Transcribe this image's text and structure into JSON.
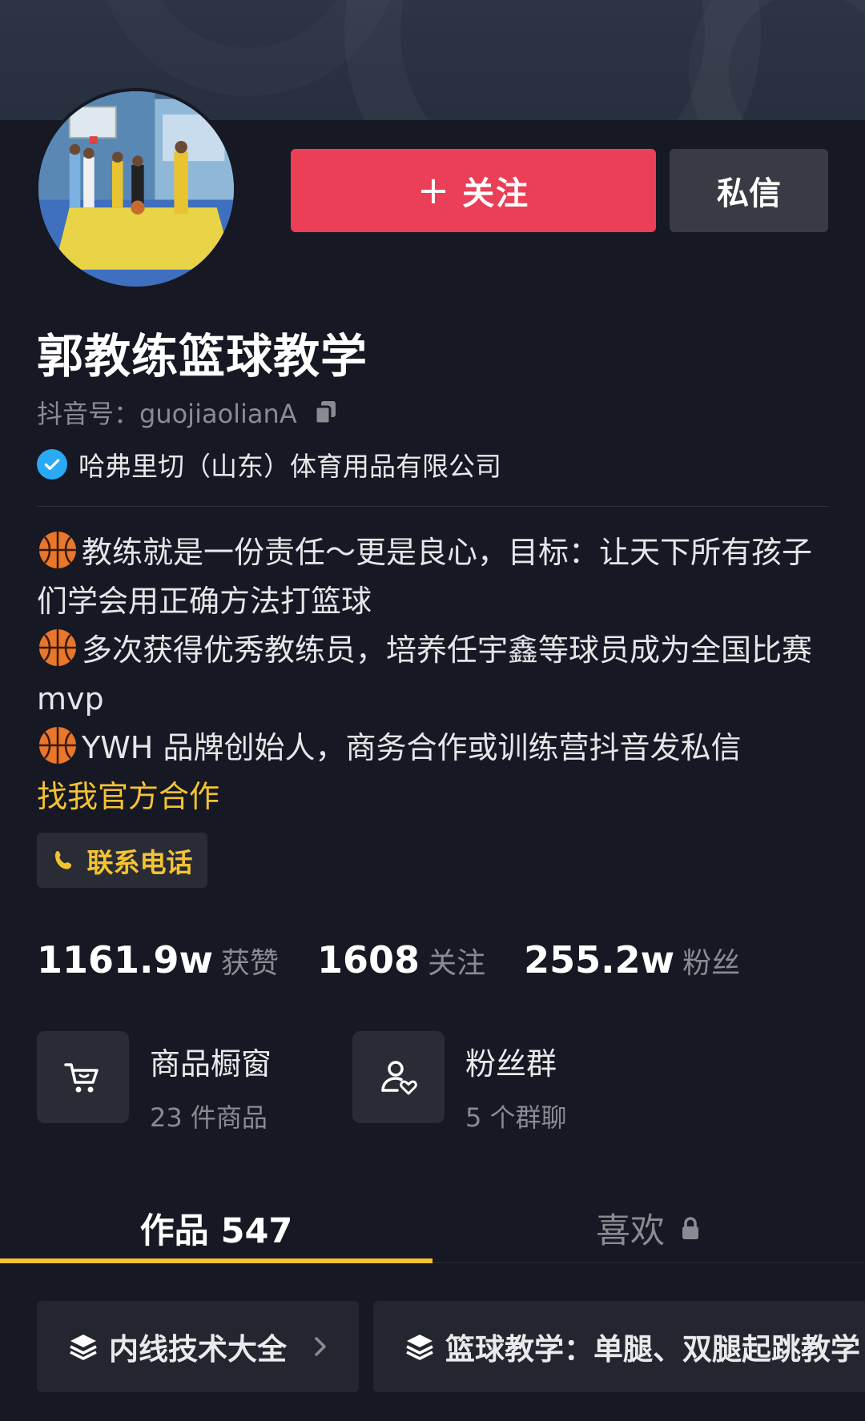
{
  "profile": {
    "name": "郭教练篮球教学",
    "douyin_id": "抖音号：guojiaolianA",
    "verified_org": "哈弗里切（山东）体育用品有限公司"
  },
  "actions": {
    "follow_label": "关注",
    "message_label": "私信"
  },
  "bio": {
    "line1": "教练就是一份责任～更是良心，目标：让天下所有孩子们学会用正确方法打篮球",
    "line2": "多次获得优秀教练员，培养任宇鑫等球员成为全国比赛 mvp",
    "line3": "YWH 品牌创始人，商务合作或训练营抖音发私信",
    "link": "找我官方合作"
  },
  "contact": {
    "phone_label": "联系电话"
  },
  "stats": [
    {
      "value": "1161.9w",
      "label": "获赞"
    },
    {
      "value": "1608",
      "label": "关注"
    },
    {
      "value": "255.2w",
      "label": "粉丝"
    }
  ],
  "tiles": {
    "shop": {
      "title": "商品橱窗",
      "subtitle": "23 件商品"
    },
    "fans_group": {
      "title": "粉丝群",
      "subtitle": "5 个群聊"
    }
  },
  "tabs": {
    "works": "作品 547",
    "likes": "喜欢"
  },
  "collections": [
    {
      "title": "内线技术大全"
    },
    {
      "title": "篮球教学：单腿、双腿起跳教学"
    }
  ],
  "colors": {
    "background": "#161823",
    "follow_red": "#ea3f56",
    "accent_yellow": "#f5c332",
    "verified_blue": "#2aa9f4"
  },
  "icons": [
    "plus-icon",
    "copy-icon",
    "verified-check-icon",
    "basketball-icon",
    "phone-icon",
    "cart-icon",
    "fans-group-icon",
    "lock-icon",
    "layers-icon",
    "chevron-right-icon"
  ]
}
